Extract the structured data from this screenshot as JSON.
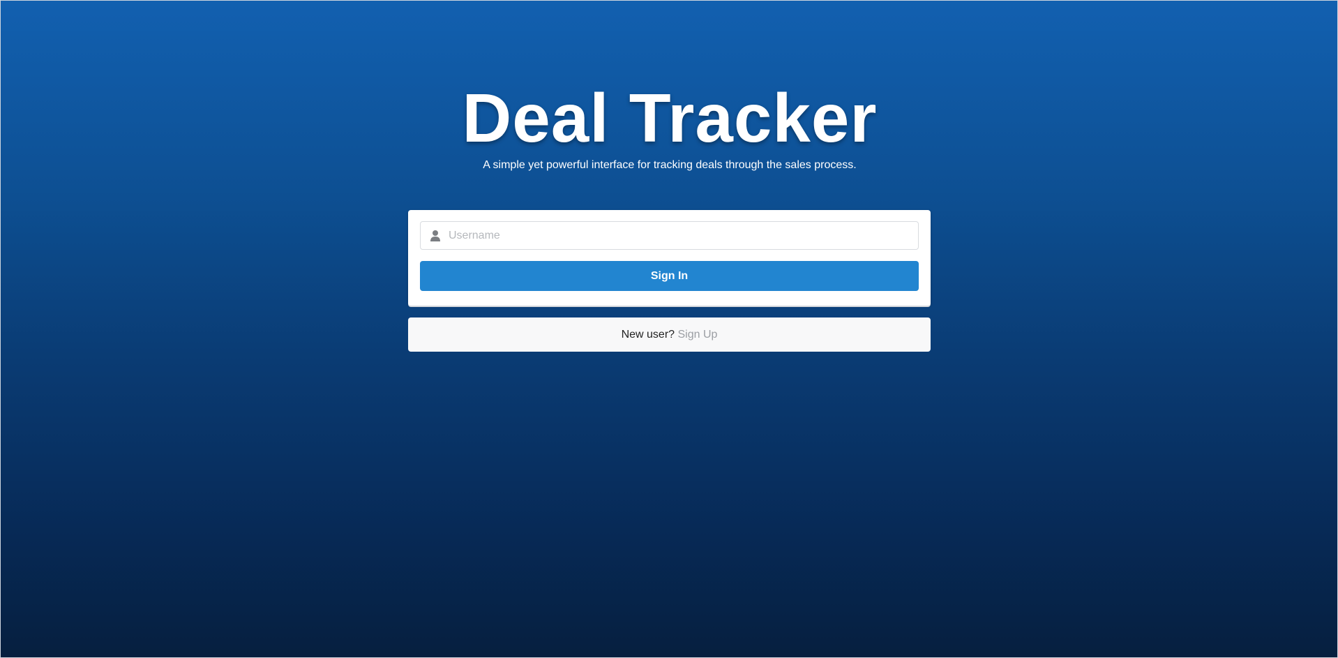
{
  "header": {
    "title": "Deal Tracker",
    "subtitle": "A simple yet powerful interface for tracking deals through the sales process."
  },
  "login_form": {
    "username_placeholder": "Username",
    "username_value": "",
    "user_icon": "user-icon",
    "signin_label": "Sign In"
  },
  "signup": {
    "prompt": "New user?",
    "link_label": "Sign Up"
  },
  "colors": {
    "background_top": "#1260b0",
    "background_bottom": "#061f3f",
    "primary_button": "#2285d0",
    "link": "#9b9ea3"
  }
}
